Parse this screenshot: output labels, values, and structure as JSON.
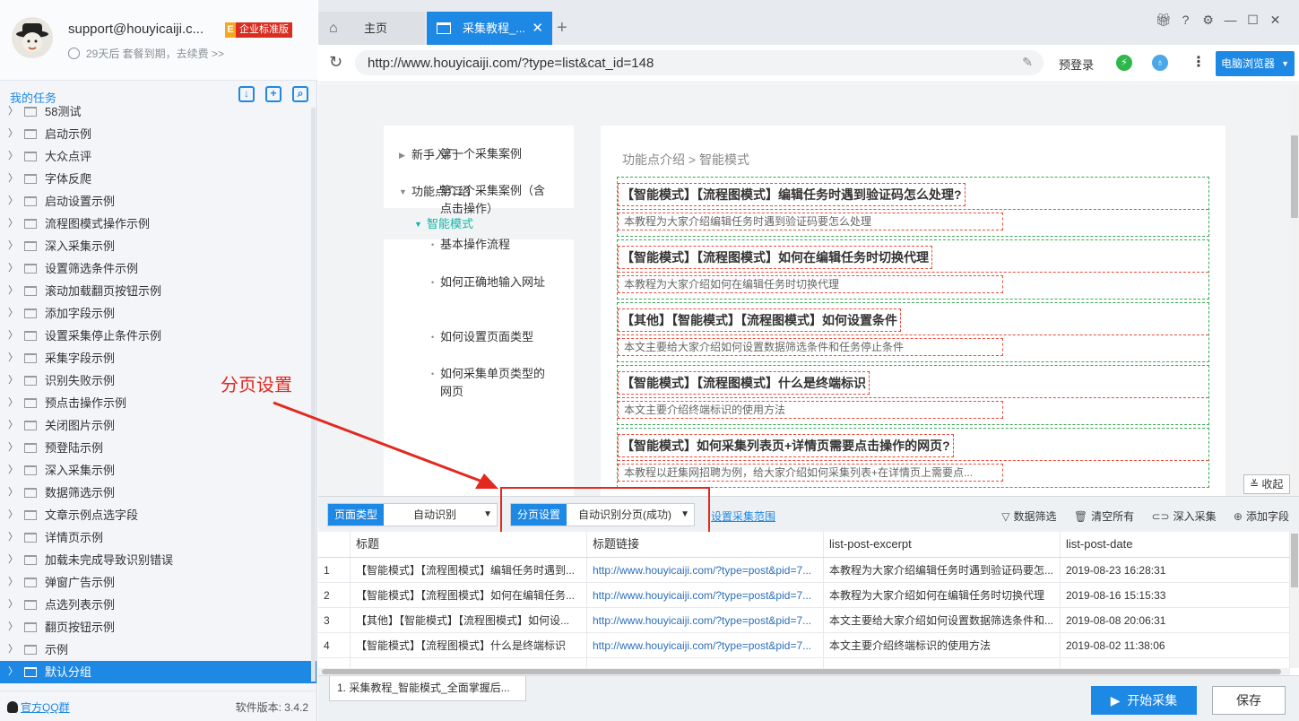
{
  "profile": {
    "email": "support@houyicaiji.c...",
    "badge_letter": "E",
    "badge_text": "企业标准版",
    "expire_text": "29天后 套餐到期，去续费 >>"
  },
  "sidebar": {
    "title": "我的任务",
    "items": [
      "58测试",
      "启动示例",
      "大众点评",
      "字体反爬",
      "启动设置示例",
      "流程图模式操作示例",
      "深入采集示例",
      "设置筛选条件示例",
      "滚动加载翻页按钮示例",
      "添加字段示例",
      "设置采集停止条件示例",
      "采集字段示例",
      "识别失败示例",
      "预点击操作示例",
      "关闭图片示例",
      "预登陆示例",
      "深入采集示例",
      "数据筛选示例",
      "文章示例点选字段",
      "详情页示例",
      "加载未完成导致识别错误",
      "弹窗广告示例",
      "点选列表示例",
      "翻页按钮示例",
      "示例",
      "默认分组"
    ],
    "selected_index": 25,
    "qq_group": "官方QQ群",
    "version": "软件版本: 3.4.2"
  },
  "tabs": {
    "home_label": "主页",
    "active_label": "采集教程_...",
    "close": "✕",
    "add": "+"
  },
  "addressbar": {
    "url": "http://www.houyicaiji.com/?type=list&cat_id=148",
    "prelogin": "预登录",
    "browser_mode": "电脑浏览器"
  },
  "web": {
    "nav": {
      "item1": "新手入门",
      "item2": "功能点介绍",
      "active": "智能模式",
      "subs": [
        "第一个采集案例",
        "第二个采集案例（含点击操作）",
        "基本操作流程",
        "如何正确地输入网址",
        "如何设置页面类型",
        "如何采集单页类型的网页"
      ]
    },
    "breadcrumb": "功能点介绍 > 智能模式",
    "articles": [
      {
        "title": "【智能模式】【流程图模式】编辑任务时遇到验证码怎么处理?",
        "excerpt": "本教程为大家介绍编辑任务时遇到验证码要怎么处理"
      },
      {
        "title": "【智能模式】【流程图模式】如何在编辑任务时切换代理",
        "excerpt": "本教程为大家介绍如何在编辑任务时切换代理"
      },
      {
        "title": "【其他】【智能模式】【流程图模式】如何设置条件",
        "excerpt": "本文主要给大家介绍如何设置数据筛选条件和任务停止条件"
      },
      {
        "title": "【智能模式】【流程图模式】什么是终端标识",
        "excerpt": "本文主要介绍终端标识的使用方法"
      },
      {
        "title": "【智能模式】如何采集列表页+详情页需要点击操作的网页?",
        "excerpt": "本教程以赶集网招聘为例，给大家介绍如何采集列表+在详情页上需要点..."
      }
    ],
    "collapse": "收起"
  },
  "annotation": {
    "label": "分页设置",
    "color": "#e3281e"
  },
  "config": {
    "page_type_tag": "页面类型",
    "page_type_value": "自动识别",
    "paging_tag": "分页设置",
    "paging_value": "自动识别分页(成功)",
    "scope_link": "设置采集范围",
    "filter": "数据筛选",
    "clear": "清空所有",
    "deep": "深入采集",
    "add_field": "添加字段"
  },
  "table": {
    "headers": [
      "",
      "标题",
      "标题链接",
      "list-post-excerpt",
      "list-post-date"
    ],
    "rows": [
      [
        "1",
        "【智能模式】【流程图模式】编辑任务时遇到...",
        "http://www.houyicaiji.com/?type=post&pid=7...",
        "本教程为大家介绍编辑任务时遇到验证码要怎...",
        "2019-08-23 16:28:31"
      ],
      [
        "2",
        "【智能模式】【流程图模式】如何在编辑任务...",
        "http://www.houyicaiji.com/?type=post&pid=7...",
        "本教程为大家介绍如何在编辑任务时切换代理",
        "2019-08-16 15:15:33"
      ],
      [
        "3",
        "【其他】【智能模式】【流程图模式】如何设...",
        "http://www.houyicaiji.com/?type=post&pid=7...",
        "本文主要给大家介绍如何设置数据筛选条件和...",
        "2019-08-08 20:06:31"
      ],
      [
        "4",
        "【智能模式】【流程图模式】什么是终端标识",
        "http://www.houyicaiji.com/?type=post&pid=7...",
        "本文主要介绍终端标识的使用方法",
        "2019-08-02 11:38:06"
      ]
    ]
  },
  "bottom": {
    "task_tab": "1. 采集教程_智能模式_全面掌握后...",
    "start": "开始采集",
    "save": "保存"
  }
}
